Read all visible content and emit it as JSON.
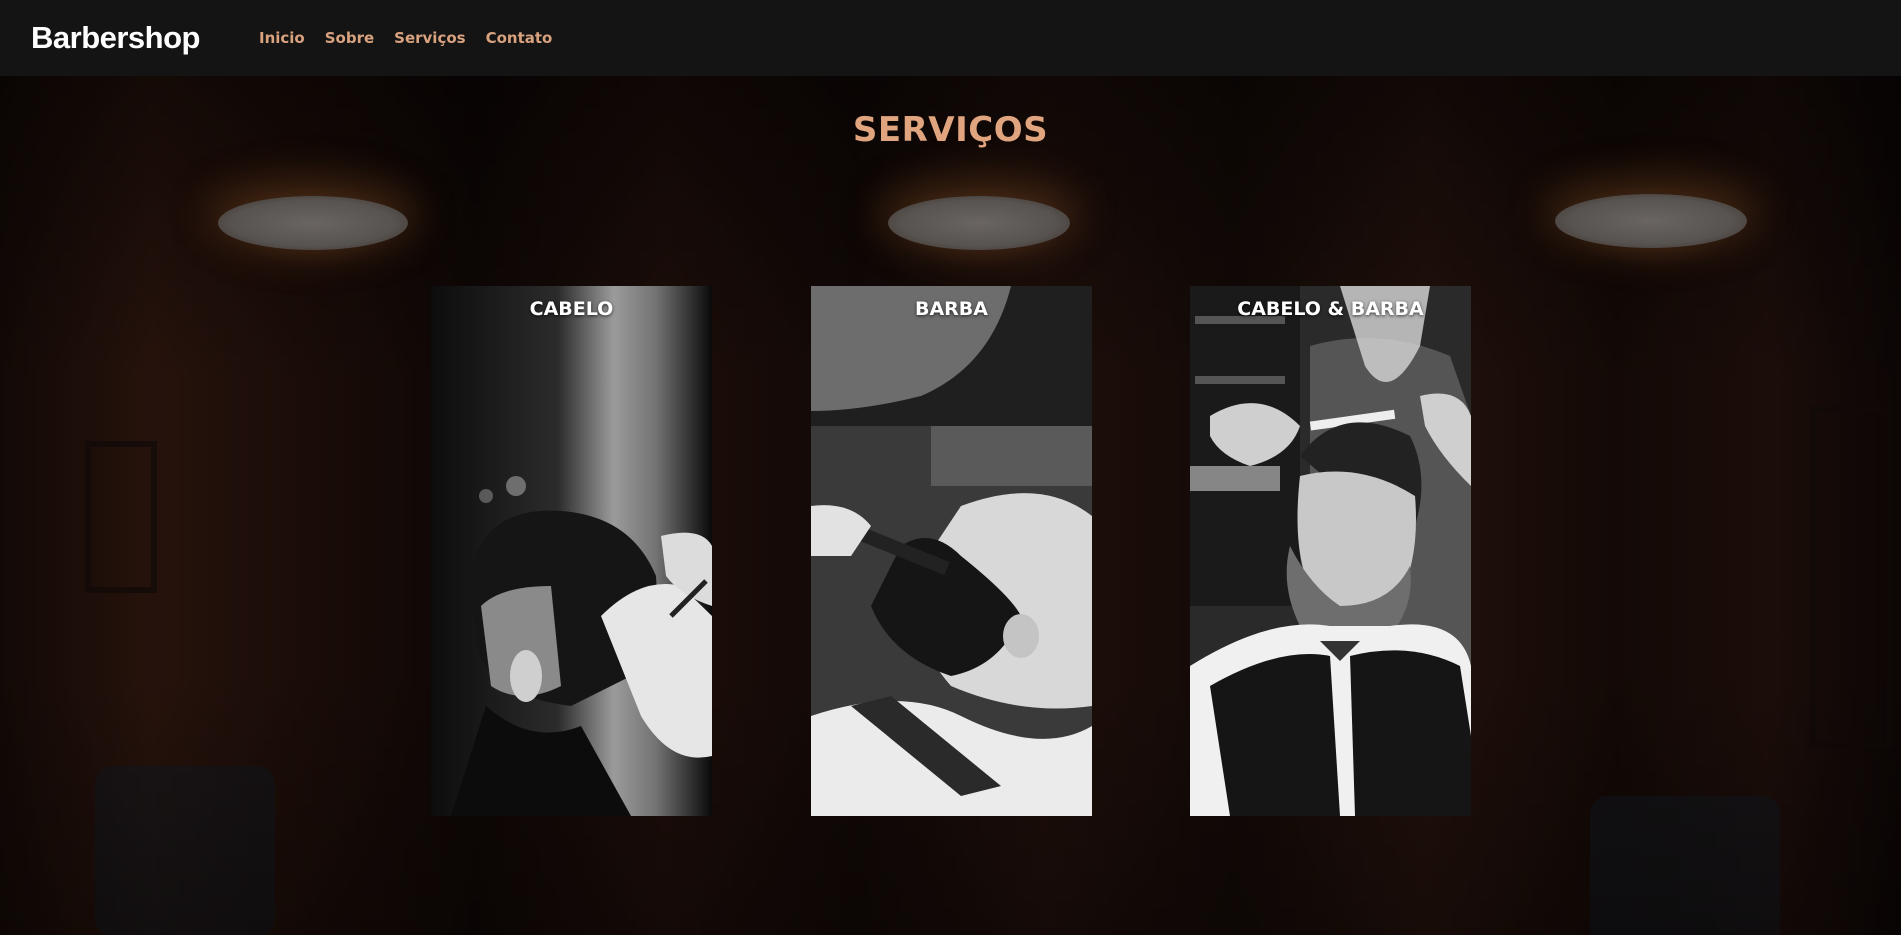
{
  "header": {
    "logo": "Barbershop",
    "nav": [
      "Inicio",
      "Sobre",
      "Serviços",
      "Contato"
    ]
  },
  "services": {
    "title": "SERVIÇOS",
    "cards": [
      {
        "title": "CABELO"
      },
      {
        "title": "BARBA"
      },
      {
        "title": "CABELO & BARBA"
      }
    ]
  },
  "colors": {
    "accent": "#d9a27e",
    "header_bg": "#141414"
  }
}
